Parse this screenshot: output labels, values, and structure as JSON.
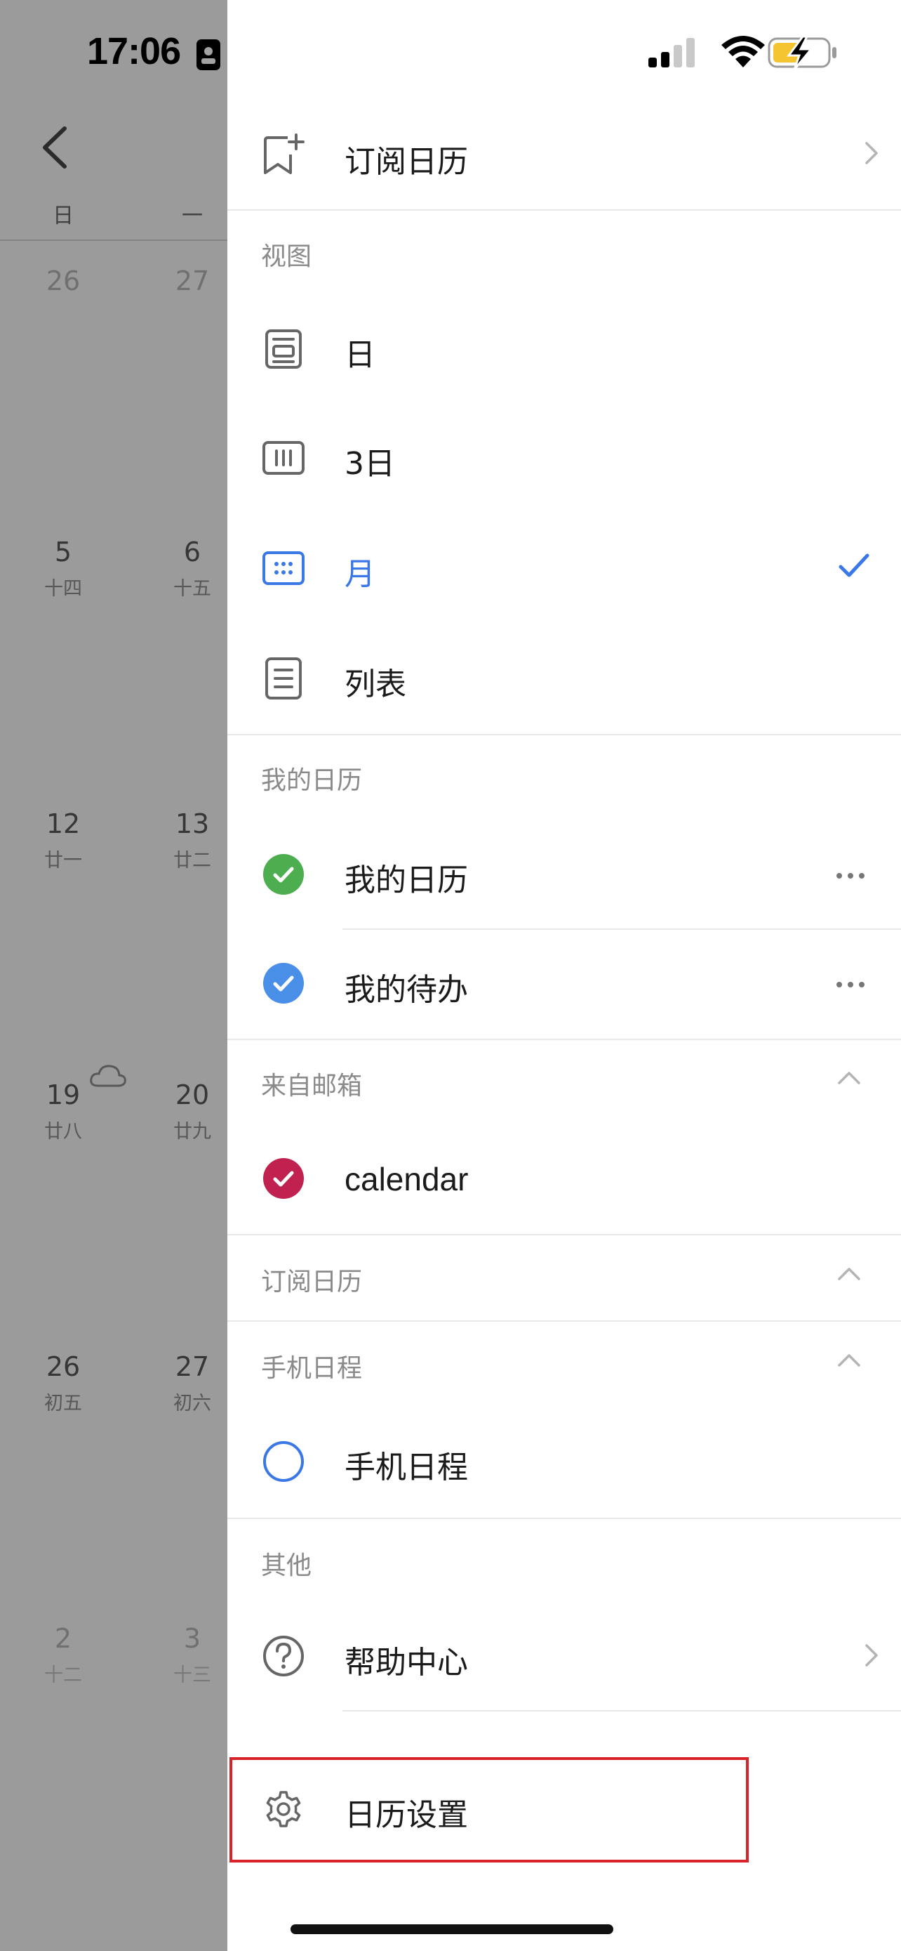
{
  "status_bar": {
    "time": "17:06"
  },
  "background_calendar": {
    "weekdays": [
      "日",
      "一"
    ],
    "weeks": [
      [
        {
          "day": "26",
          "lunar": ""
        },
        {
          "day": "27",
          "lunar": ""
        }
      ],
      [
        {
          "day": "5",
          "lunar": "十四"
        },
        {
          "day": "6",
          "lunar": "十五"
        }
      ],
      [
        {
          "day": "12",
          "lunar": "廿一"
        },
        {
          "day": "13",
          "lunar": "廿二"
        }
      ],
      [
        {
          "day": "19",
          "lunar": "廿八"
        },
        {
          "day": "20",
          "lunar": "廿九"
        }
      ],
      [
        {
          "day": "26",
          "lunar": "初五"
        },
        {
          "day": "27",
          "lunar": "初六"
        }
      ],
      [
        {
          "day": "2",
          "lunar": "十二"
        },
        {
          "day": "3",
          "lunar": "十三"
        }
      ]
    ]
  },
  "drawer": {
    "subscribe": {
      "label": "订阅日历"
    },
    "view_section": {
      "title": "视图",
      "items": [
        {
          "label": "日",
          "icon": "day-view-icon",
          "selected": false
        },
        {
          "label": "3日",
          "icon": "three-day-view-icon",
          "selected": false
        },
        {
          "label": "月",
          "icon": "month-view-icon",
          "selected": true
        },
        {
          "label": "列表",
          "icon": "list-view-icon",
          "selected": false
        }
      ]
    },
    "my_calendars": {
      "title": "我的日历",
      "items": [
        {
          "label": "我的日历",
          "color": "#4cae4f"
        },
        {
          "label": "我的待办",
          "color": "#4a8fe7"
        }
      ]
    },
    "from_email": {
      "title": "来自邮箱",
      "items": [
        {
          "label": "calendar",
          "color": "#c0214f"
        }
      ]
    },
    "subscribed": {
      "title": "订阅日历"
    },
    "phone": {
      "title": "手机日程",
      "items": [
        {
          "label": "手机日程",
          "color": "#3b78e7"
        }
      ]
    },
    "other": {
      "title": "其他",
      "items": [
        {
          "label": "帮助中心",
          "icon": "help-icon"
        },
        {
          "label": "日历设置",
          "icon": "gear-icon"
        }
      ]
    }
  },
  "colors": {
    "accent": "#3b78e7",
    "highlight_box": "#d8232a"
  }
}
